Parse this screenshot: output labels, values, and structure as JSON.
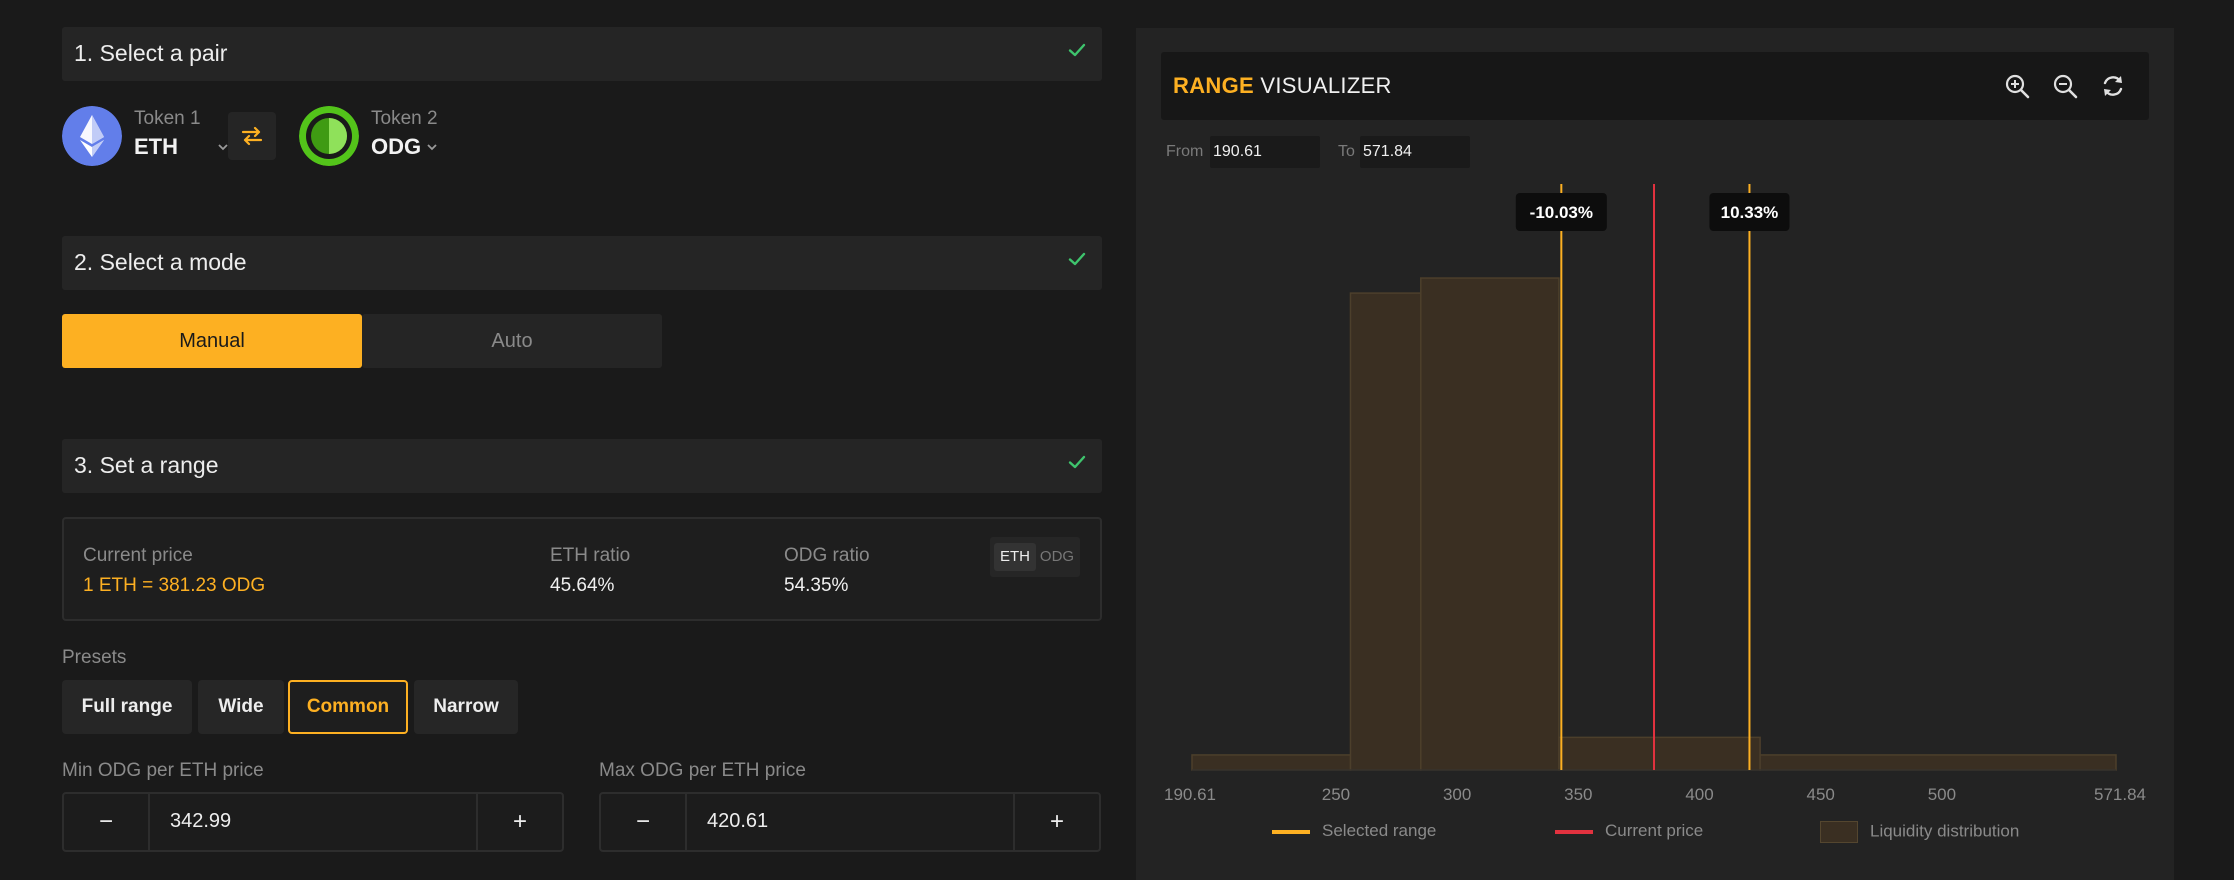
{
  "steps": {
    "pair_title": "1. Select a pair",
    "mode_title": "2. Select a mode",
    "range_title": "3. Set a range"
  },
  "tokens": {
    "token1": {
      "label": "Token 1",
      "symbol": "ETH"
    },
    "token2": {
      "label": "Token 2",
      "symbol": "ODG"
    }
  },
  "mode": {
    "manual": "Manual",
    "auto": "Auto",
    "selected": "Manual"
  },
  "price_card": {
    "current_price_label": "Current price",
    "current_price_value": "1 ETH = 381.23 ODG",
    "eth_ratio_label": "ETH ratio",
    "eth_ratio_value": "45.64%",
    "odg_ratio_label": "ODG ratio",
    "odg_ratio_value": "54.35%",
    "unit_options": [
      "ETH",
      "ODG"
    ],
    "unit_selected": "ETH"
  },
  "presets": {
    "label": "Presets",
    "items": [
      "Full range",
      "Wide",
      "Common",
      "Narrow"
    ],
    "selected": "Common"
  },
  "min_price": {
    "label": "Min ODG per ETH price",
    "value": "342.99",
    "minus": "−",
    "plus": "+"
  },
  "max_price": {
    "label": "Max ODG per ETH price",
    "value": "420.61",
    "minus": "−",
    "plus": "+"
  },
  "visualizer": {
    "title_accent": "RANGE",
    "title_rest": "VISUALIZER",
    "from_label": "From",
    "from_value": "190.61",
    "to_label": "To",
    "to_value": "571.84",
    "icons": [
      "zoom-in-icon",
      "zoom-out-icon",
      "refresh-icon"
    ]
  },
  "legend": {
    "selected_range": "Selected range",
    "current_price": "Current price",
    "liquidity": "Liquidity distribution"
  },
  "colors": {
    "accent": "#fdb022",
    "current_price_line": "#e2323f",
    "liquidity_fill": "#3a2f22",
    "check": "#3ec46d"
  },
  "chart_data": {
    "type": "area",
    "x_range": [
      190.61,
      571.84
    ],
    "tick_labels": [
      "190.61",
      "250",
      "300",
      "350",
      "400",
      "450",
      "500",
      "571.84"
    ],
    "tick_values": [
      190.61,
      250,
      300,
      350,
      400,
      450,
      500,
      571.84
    ],
    "range_min": 342.99,
    "range_max": 420.61,
    "current_price": 381.23,
    "range_min_label": "-10.03%",
    "range_max_label": "10.33%",
    "liquidity_steps": [
      {
        "x0": 190.61,
        "x1": 256,
        "y": 0.03
      },
      {
        "x0": 256,
        "x1": 285,
        "y": 0.95
      },
      {
        "x0": 285,
        "x1": 342,
        "y": 0.98
      },
      {
        "x0": 342,
        "x1": 425,
        "y": 0.065
      },
      {
        "x0": 425,
        "x1": 571.84,
        "y": 0.03
      }
    ]
  }
}
